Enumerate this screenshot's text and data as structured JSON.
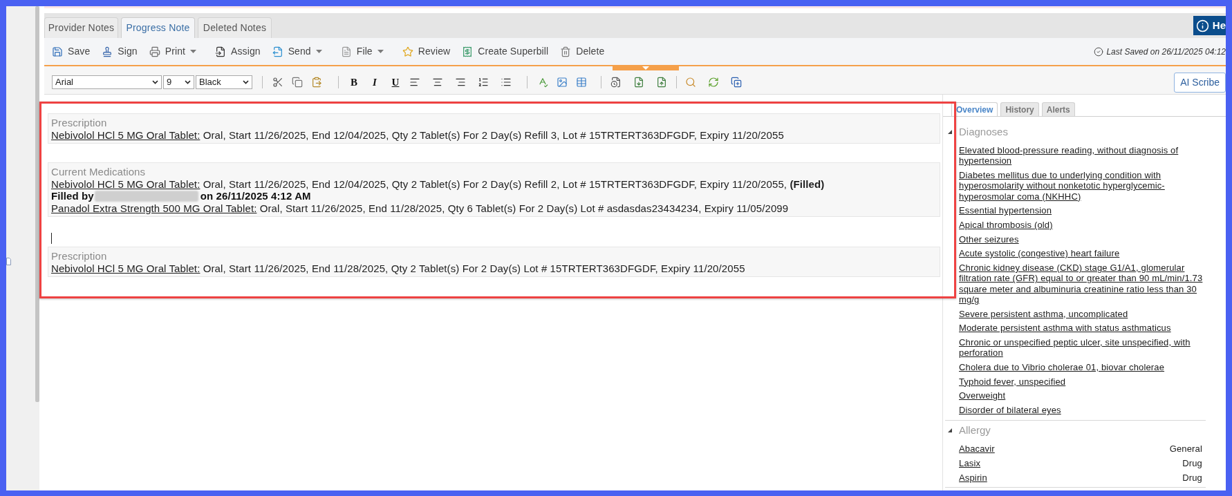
{
  "tabs": [
    {
      "label": "Provider Notes",
      "selected": false
    },
    {
      "label": "Progress Note",
      "selected": true
    },
    {
      "label": "Deleted Notes",
      "selected": false
    }
  ],
  "help_button": "He",
  "toolbar": {
    "buttons": [
      {
        "label": "Save",
        "has_menu": false
      },
      {
        "label": "Sign",
        "has_menu": false
      },
      {
        "label": "Print",
        "has_menu": true
      },
      {
        "label": "Assign",
        "has_menu": false
      },
      {
        "label": "Send",
        "has_menu": true
      },
      {
        "label": "File",
        "has_menu": true
      },
      {
        "label": "Review",
        "has_menu": false
      },
      {
        "label": "Create Superbill",
        "has_menu": false
      },
      {
        "label": "Delete",
        "has_menu": false
      }
    ],
    "last_saved": "Last Saved on 26/11/2025 04:12"
  },
  "format_bar": {
    "font": "Arial",
    "size": "9",
    "font_color": "Black",
    "style_buttons": [
      "B",
      "I",
      "U"
    ],
    "ai_button": "AI Scribe"
  },
  "note": {
    "highlighted": true,
    "sections": [
      {
        "heading": "Prescription",
        "entries": [
          {
            "kind": "medication",
            "drug": "Nebivolol HCl 5 MG Oral Tablet:",
            "details": "Oral, Start 11/26/2025, End 12/04/2025, Qty 2 Tablet(s) For 2 Day(s) Refill 3, Lot # 15TRTERT363DFGDF, Expiry 11/20/2055"
          }
        ]
      },
      {
        "heading": "Current Medications",
        "entries": [
          {
            "kind": "medication",
            "drug": "Nebivolol HCl 5 MG Oral Tablet:",
            "details": "Oral, Start 11/26/2025, End 12/04/2025, Qty 2 Tablet(s) For 2 Day(s) Refill 2, Lot # 15TRTERT363DFGDF, Expiry 11/20/2055, **(Filled)**"
          },
          {
            "kind": "filled_by",
            "label": "Filled by",
            "name_redacted": true,
            "date": "on 26/11/2025 4:12 AM"
          },
          {
            "kind": "medication",
            "drug": "Panadol Extra Strength 500 MG Oral Tablet:",
            "details": "Oral, Start 11/26/2025, End 11/28/2025, Qty 6 Tablet(s) For 2 Day(s) Lot # asdasdas23434234, Expiry 11/05/2099"
          }
        ]
      },
      {
        "heading": "Prescription",
        "cursor_before": true,
        "entries": [
          {
            "kind": "medication",
            "drug": "Nebivolol HCl 5 MG Oral Tablet:",
            "details": "Oral, Start 11/26/2025, End 11/28/2025, Qty 2 Tablet(s) For 2 Day(s) Lot # 15TRTERT363DFGDF, Expiry 11/20/2055"
          }
        ]
      }
    ]
  },
  "side_panel": {
    "tabs": [
      {
        "label": "Overview",
        "selected": true
      },
      {
        "label": "History",
        "selected": false
      },
      {
        "label": "Alerts",
        "selected": false
      }
    ],
    "sections": [
      {
        "kind": "diagnoses",
        "title": "Diagnoses",
        "expanded": true,
        "items": [
          {
            "name": "Elevated blood-pressure reading, without diagnosis of hypertension"
          },
          {
            "name": "Diabetes mellitus due to underlying condition with hyperosmolarity without nonketotic hyperglycemic-hyperosmolar coma (NKHHC)"
          },
          {
            "name": "Essential hypertension"
          },
          {
            "name": "Apical thrombosis (old)"
          },
          {
            "name": "Other seizures"
          },
          {
            "name": "Acute systolic (congestive) heart failure"
          },
          {
            "name": "Chronic kidney disease (CKD) stage G1/A1, glomerular filtration rate (GFR) equal to or greater than 90 mL/min/1.73 square meter and albuminuria creatinine ratio less than 30 mg/g"
          },
          {
            "name": "Severe persistent asthma, uncomplicated"
          },
          {
            "name": "Moderate persistent asthma with status asthmaticus"
          },
          {
            "name": "Chronic or unspecified peptic ulcer, site unspecified, with perforation"
          },
          {
            "name": "Cholera due to Vibrio cholerae 01, biovar cholerae"
          },
          {
            "name": "Typhoid fever, unspecified"
          },
          {
            "name": "Overweight"
          },
          {
            "name": "Disorder of bilateral eyes"
          }
        ]
      },
      {
        "kind": "allergies",
        "title": "Allergy",
        "expanded": true,
        "items": [
          {
            "name": "Abacavir",
            "type": "General"
          },
          {
            "name": "Lasix",
            "type": "Drug"
          },
          {
            "name": "Aspirin",
            "type": "Drug"
          }
        ]
      }
    ]
  }
}
